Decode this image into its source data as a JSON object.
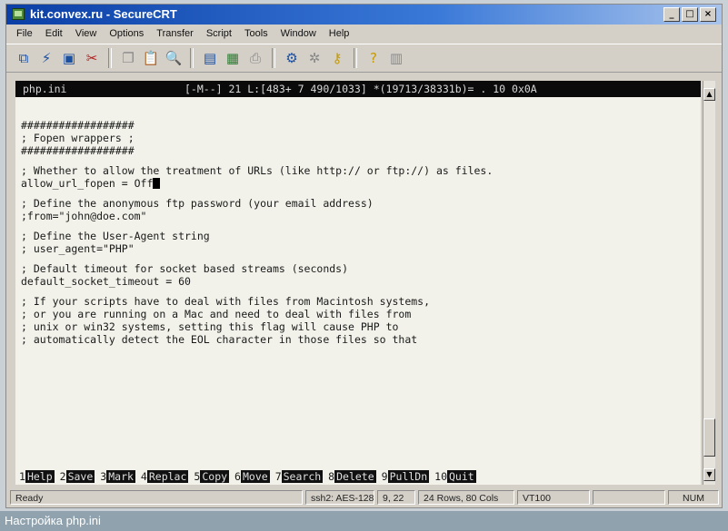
{
  "window": {
    "title": "kit.convex.ru - SecureCRT",
    "controls": {
      "minimize": "_",
      "maximize": "□",
      "close": "×"
    }
  },
  "menu": [
    "File",
    "Edit",
    "View",
    "Options",
    "Transfer",
    "Script",
    "Tools",
    "Window",
    "Help"
  ],
  "toolbar": {
    "icons": [
      "connect-icon",
      "quick-connect-icon",
      "connect-tab-icon",
      "disconnect-icon",
      "copy-icon",
      "paste-icon",
      "find-icon",
      "print-setup-icon",
      "print-icon",
      "print-screen-icon",
      "session-options-icon",
      "global-options-icon",
      "key-icon",
      "help-icon",
      "about-icon"
    ]
  },
  "terminal": {
    "status": {
      "file": "php.ini",
      "info": "[-M--] 21 L:[483+ 7 490/1033] *(19713/38331b)= . 10 0x0A"
    },
    "lines": [
      "##################",
      "; Fopen wrappers ;",
      "##################",
      "",
      "; Whether to allow the treatment of URLs (like http:// or ftp://) as files.",
      "allow_url_fopen = Off",
      "",
      "; Define the anonymous ftp password (your email address)",
      ";from=\"john@doe.com\"",
      "",
      "; Define the User-Agent string",
      "; user_agent=\"PHP\"",
      "",
      "; Default timeout for socket based streams (seconds)",
      "default_socket_timeout = 60",
      "",
      "; If your scripts have to deal with files from Macintosh systems,",
      "; or you are running on a Mac and need to deal with files from",
      "; unix or win32 systems, setting this flag will cause PHP to",
      "; automatically detect the EOL character in those files so that"
    ],
    "fkeys": [
      {
        "num": "1",
        "label": "Help"
      },
      {
        "num": "2",
        "label": "Save"
      },
      {
        "num": "3",
        "label": "Mark"
      },
      {
        "num": "4",
        "label": "Replac"
      },
      {
        "num": "5",
        "label": "Copy"
      },
      {
        "num": "6",
        "label": "Move"
      },
      {
        "num": "7",
        "label": "Search"
      },
      {
        "num": "8",
        "label": "Delete"
      },
      {
        "num": "9",
        "label": "PullDn"
      },
      {
        "num": "10",
        "label": "Quit"
      }
    ]
  },
  "statusbar": {
    "ready": "Ready",
    "connection": "ssh2: AES-128",
    "position": "9, 22",
    "size": "24 Rows, 80 Cols",
    "emulation": "VT100",
    "blank": "",
    "num": "NUM"
  },
  "caption": "Настройка php.ini"
}
